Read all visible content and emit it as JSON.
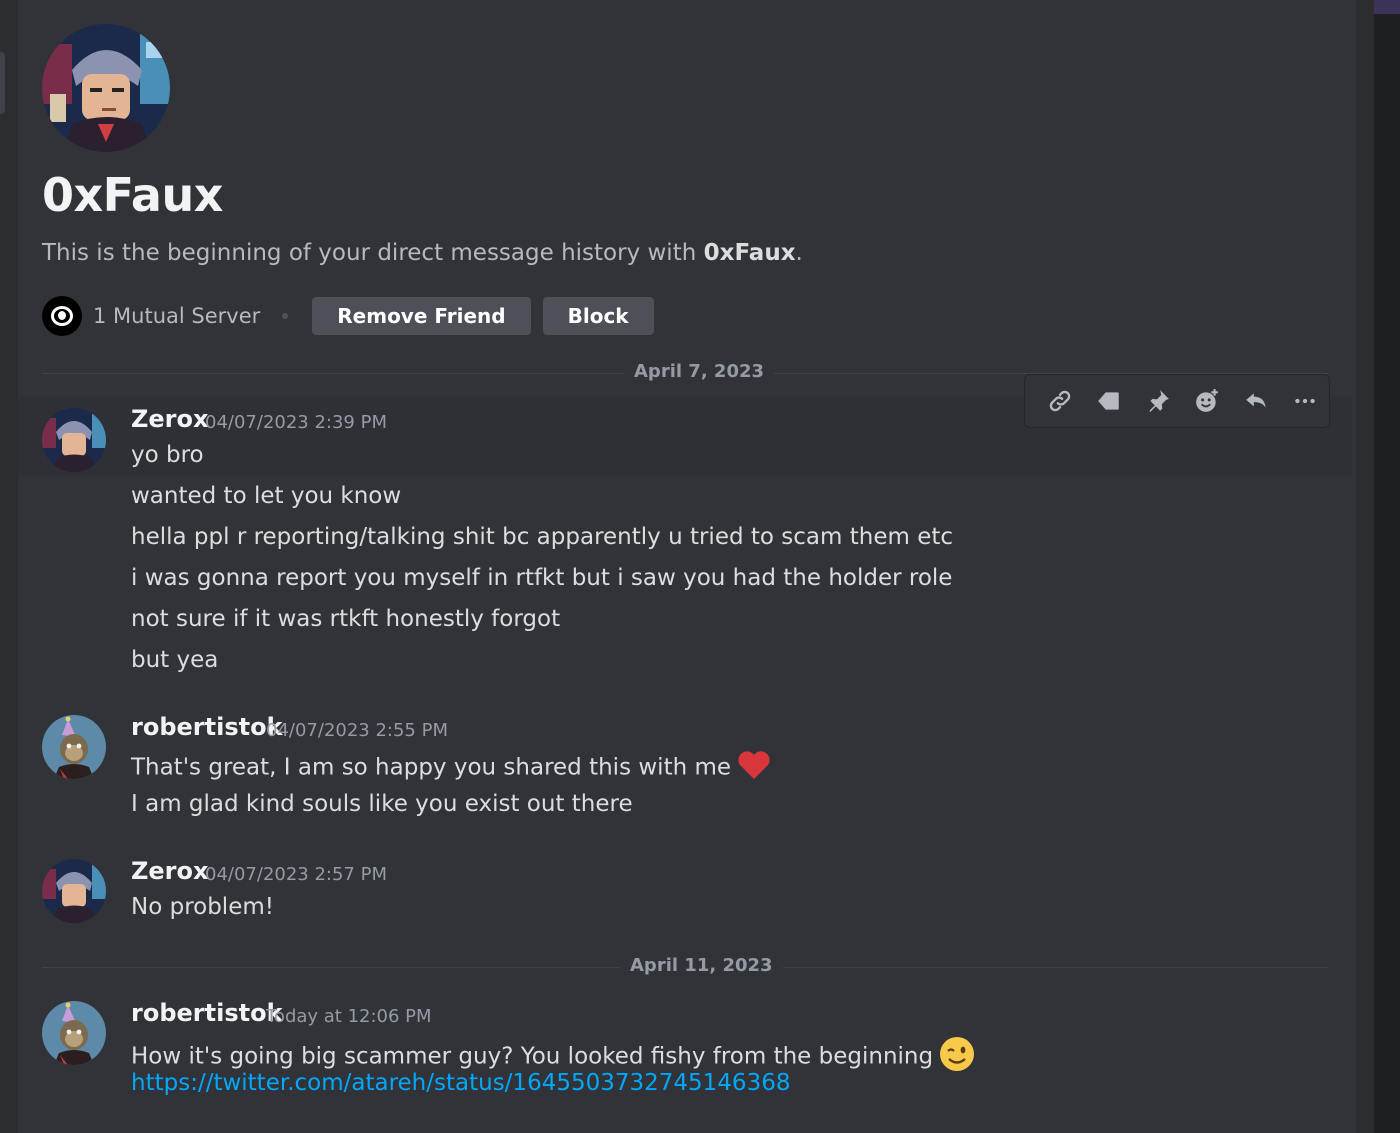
{
  "profile": {
    "name": "0xFaux",
    "intro_prefix": "This is the beginning of your direct message history with ",
    "intro_name": "0xFaux",
    "intro_suffix": ".",
    "mutual_servers": "1 Mutual Server",
    "remove_friend_label": "Remove Friend",
    "block_label": "Block"
  },
  "toolbar": {
    "icons": [
      "link-icon",
      "tag-icon",
      "pin-icon",
      "add-reaction-icon",
      "reply-icon",
      "more-icon"
    ]
  },
  "dividers": {
    "first": "April 7, 2023",
    "second": "April 11, 2023"
  },
  "messages": [
    {
      "author": "Zerox",
      "timestamp": "04/07/2023 2:39 PM",
      "lines": [
        "yo bro",
        "wanted to let you know",
        "hella ppl r reporting/talking shit bc apparently u tried to scam them etc",
        "i was gonna report you myself in rtfkt but i saw you had the holder role",
        "not sure if it was rtkft honestly forgot",
        "but yea"
      ]
    },
    {
      "author": "robertistok",
      "timestamp": "04/07/2023 2:55 PM",
      "lines": [
        "That's great, I am so happy you shared this with me",
        "I am glad kind souls like you exist out there"
      ],
      "emoji": "heart"
    },
    {
      "author": "Zerox",
      "timestamp": "04/07/2023 2:57 PM",
      "lines": [
        "No problem!"
      ]
    },
    {
      "author": "robertistok",
      "timestamp": "Today at 12:06 PM",
      "lines": [
        "How it's going big scammer guy? You looked fishy from the beginning"
      ],
      "emoji": "wink",
      "link": "https://twitter.com/atareh/status/1645503732745146368"
    }
  ],
  "colors": {
    "background": "#313338",
    "link": "#00a8fc",
    "button": "#4e5058",
    "heart": "#da373c"
  }
}
